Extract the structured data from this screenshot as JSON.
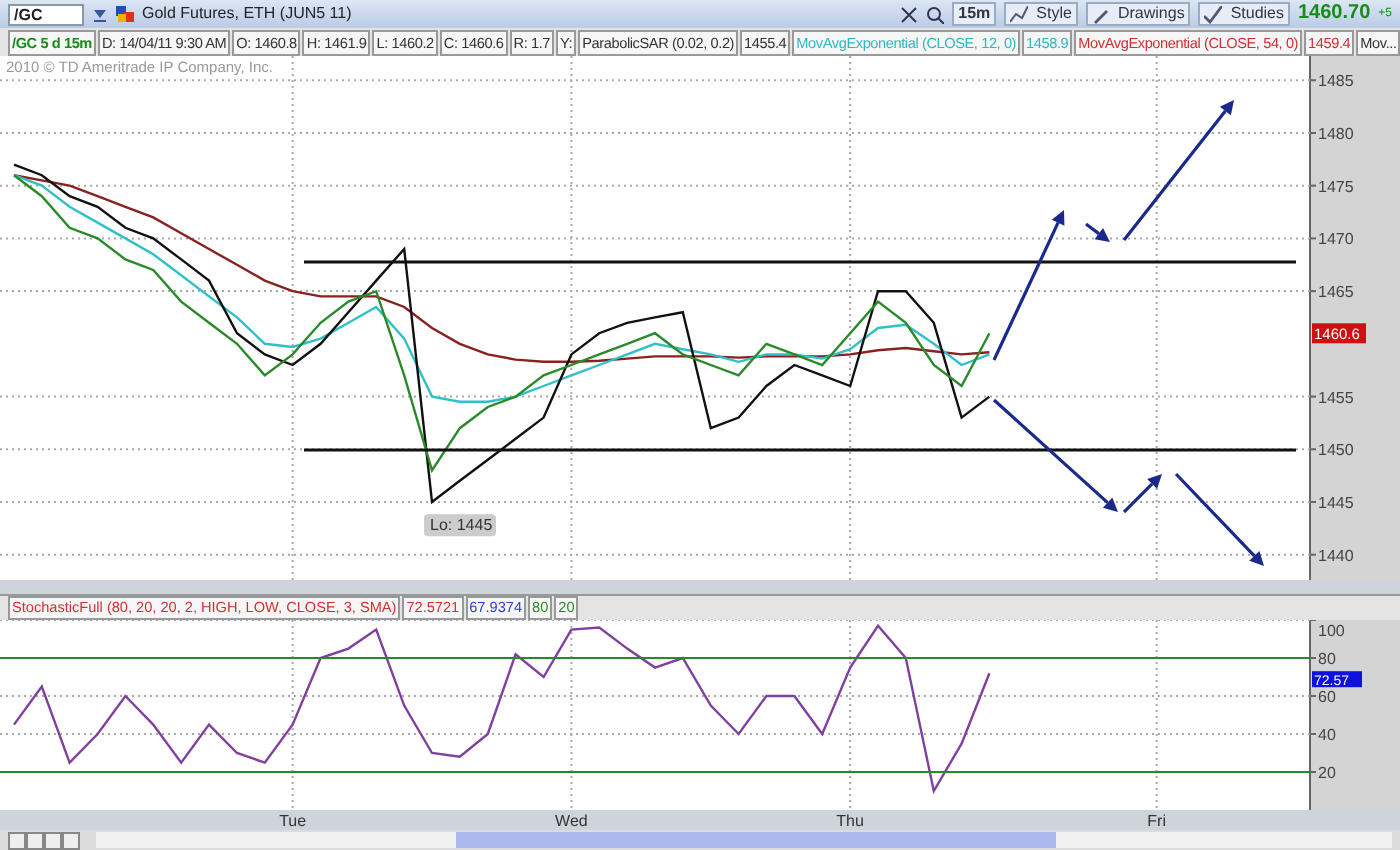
{
  "toolbar": {
    "symbol": "/GC",
    "title": "Gold Futures, ETH (JUN5 11)",
    "buttons": [
      {
        "label": "15m",
        "kind": "interval"
      },
      {
        "label": "Style",
        "kind": "style"
      },
      {
        "label": "Drawings",
        "kind": "drawings"
      },
      {
        "label": "Studies",
        "kind": "studies"
      }
    ],
    "last_price": "1460.70",
    "change": "+5"
  },
  "info_row": [
    {
      "text": "/GC 5 d 15m",
      "kind": "symbol"
    },
    {
      "text": "D: 14/04/11 9:30 AM",
      "kind": "plain"
    },
    {
      "text": "O: 1460.8",
      "kind": "plain"
    },
    {
      "text": "H: 1461.9",
      "kind": "plain"
    },
    {
      "text": "L: 1460.2",
      "kind": "plain"
    },
    {
      "text": "C: 1460.6",
      "kind": "plain"
    },
    {
      "text": "R: 1.7",
      "kind": "plain"
    },
    {
      "text": "Y:",
      "kind": "plain"
    },
    {
      "text": "ParabolicSAR (0.02, 0.2)",
      "kind": "plain"
    },
    {
      "text": "1455.4",
      "kind": "plain"
    },
    {
      "text": "MovAvgExponential (CLOSE, 12, 0)",
      "kind": "cyan"
    },
    {
      "text": "1458.9",
      "kind": "cyan"
    },
    {
      "text": "MovAvgExponential (CLOSE, 54, 0)",
      "kind": "red"
    },
    {
      "text": "1459.4",
      "kind": "red"
    },
    {
      "text": "Mov...",
      "kind": "plain"
    }
  ],
  "price_panel": {
    "copyright": "2010 © TD Ameritrade IP Company, Inc.",
    "price_tag": "1460.6",
    "chart_data": {
      "type": "line",
      "grid": true,
      "ylim": [
        1437.6,
        1487.3
      ],
      "yticks": [
        1440,
        1445,
        1450,
        1455,
        1465,
        1470,
        1475,
        1480,
        1485
      ],
      "series": [
        {
          "color": "#8b2020",
          "values": [
            1476,
            1475.5,
            1475,
            1474,
            1473,
            1472,
            1470.5,
            1469,
            1467.5,
            1466,
            1465,
            1464.5,
            1464.5,
            1464.5,
            1463.5,
            1461.5,
            1460,
            1459,
            1458.5,
            1458.3,
            1458.3,
            1458.4,
            1458.6,
            1458.8,
            1458.8,
            1458.8,
            1458.7,
            1458.8,
            1458.8,
            1458.8,
            1459,
            1459.4,
            1459.6,
            1459.3,
            1459,
            1459.2,
            null,
            null,
            null,
            null,
            null,
            null,
            null,
            null,
            null,
            null,
            null
          ]
        },
        {
          "color": "#30c0c8",
          "values": [
            1476,
            1475,
            1473,
            1471.5,
            1470,
            1468.5,
            1466.5,
            1464.5,
            1462.5,
            1460,
            1459.7,
            1460.5,
            1462,
            1463.5,
            1460.5,
            1455,
            1454.5,
            1454.5,
            1455,
            1456,
            1457,
            1458,
            1459,
            1460,
            1459.5,
            1459,
            1458.3,
            1459,
            1459,
            1458.6,
            1459.5,
            1461.5,
            1461.8,
            1460,
            1458,
            1459,
            null,
            null,
            null,
            null,
            null,
            null,
            null,
            null,
            null,
            null,
            null
          ]
        },
        {
          "color": "#111111",
          "values": [
            1477,
            1476,
            1474,
            1473,
            1471,
            1470,
            1468,
            1466,
            1461,
            1459,
            1458,
            1460,
            1463,
            1466,
            1469,
            1445,
            1447,
            1449,
            1451,
            1453,
            1459,
            1461,
            1462,
            1462.5,
            1463,
            1452,
            1453,
            1456,
            1458,
            1457,
            1456,
            1465,
            1465,
            1462,
            1453,
            1455,
            null,
            null,
            null,
            null,
            null,
            null,
            null,
            null,
            null,
            null,
            null
          ]
        },
        {
          "color": "#2a8a2a",
          "values": [
            1476,
            1474,
            1471,
            1470,
            1468,
            1467,
            1464,
            1462,
            1460,
            1457,
            1459,
            1462,
            1464,
            1465,
            1457,
            1448,
            1452,
            1454,
            1455,
            1457,
            1458,
            1459,
            1460,
            1461,
            1459,
            1458,
            1457,
            1460,
            1459,
            1458,
            1461,
            1464,
            1462,
            1458,
            1456,
            1461,
            null,
            null,
            null,
            null,
            null,
            null,
            null,
            null,
            null,
            null,
            null
          ]
        }
      ],
      "annotations": [
        "Lo: 1445"
      ]
    }
  },
  "stochastic_panel": {
    "header": [
      {
        "text": "StochasticFull (80, 20, 20, 2, HIGH, LOW, CLOSE, 3, SMA)",
        "color": "#d03030"
      },
      {
        "text": "72.5721",
        "color": "#d03030"
      },
      {
        "text": "67.9374",
        "color": "#3040c0"
      },
      {
        "text": "80",
        "color": "#2a8a2a"
      },
      {
        "text": "20",
        "color": "#2a8a2a"
      }
    ],
    "value_tag": "72.57",
    "chart_data": {
      "type": "line",
      "grid": true,
      "ylim": [
        0,
        100
      ],
      "yticks": [
        20,
        40,
        60,
        80,
        100
      ],
      "categories": [
        null,
        null,
        null,
        null,
        null,
        null,
        null,
        null,
        null,
        null,
        "Tue",
        null,
        null,
        null,
        null,
        null,
        null,
        null,
        null,
        null,
        "Wed",
        null,
        null,
        null,
        null,
        null,
        null,
        null,
        null,
        null,
        "Thu",
        null,
        null,
        null,
        null,
        null,
        null,
        null,
        null,
        null,
        null,
        "Fri",
        null,
        null,
        null,
        null,
        null
      ],
      "series": [
        {
          "color": "#8040a0",
          "values": [
            45,
            65,
            25,
            40,
            60,
            45,
            25,
            45,
            30,
            25,
            45,
            80,
            85,
            95,
            55,
            30,
            28,
            40,
            82,
            70,
            95,
            96,
            85,
            75,
            80,
            55,
            40,
            60,
            60,
            40,
            75,
            97,
            80,
            10,
            35,
            72,
            null,
            null,
            null,
            null,
            null,
            null,
            null,
            null,
            null,
            null,
            null
          ]
        }
      ]
    }
  }
}
